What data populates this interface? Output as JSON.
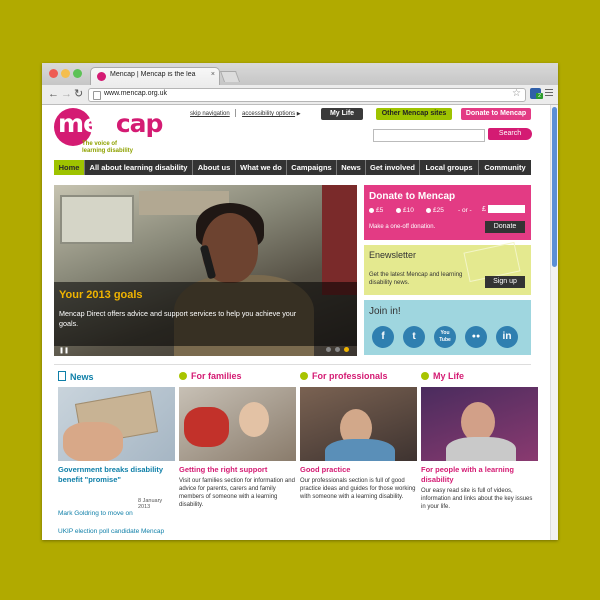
{
  "browser": {
    "tab_title": "Mencap | Mencap is the lea",
    "tab_close": "×",
    "url": "www.mencap.org.uk",
    "ext_badge": "2",
    "back": "←",
    "forward": "→",
    "reload": "↻",
    "star": "☆"
  },
  "header": {
    "logo_pre": "m",
    "logo_mid": "en",
    "logo_post": "cap",
    "tagline": "The voice of\nlearning disability",
    "skip_nav": "skip navigation",
    "accessibility": "accessibility options",
    "my_life": "My Life",
    "other_sites": "Other Mencap sites",
    "donate": "Donate to Mencap",
    "search_button": "Search"
  },
  "nav": [
    "Home",
    "All about learning disability",
    "About us",
    "What we do",
    "Campaigns",
    "News",
    "Get involved",
    "Local groups",
    "Community"
  ],
  "hero": {
    "title": "Your 2013 goals",
    "text": "Mencap Direct offers advice and support services to help you achieve your goals.",
    "controls": "❚❚"
  },
  "donate": {
    "title": "Donate to Mencap",
    "amounts": [
      "£5",
      "£10",
      "£25"
    ],
    "or": "- or -",
    "pound": "£",
    "note": "Make a one-off donation.",
    "button": "Donate"
  },
  "enewsletter": {
    "title": "Enewsletter",
    "text": "Get the latest Mencap and learning disability news.",
    "button": "Sign up"
  },
  "join": {
    "title": "Join in!",
    "icons": [
      "f",
      "t",
      "You\nTube",
      "●●",
      "in"
    ]
  },
  "columns": {
    "news": {
      "heading": "News",
      "sub": "Government breaks disability benefit \"promise\"",
      "date": "8 January 2013",
      "item2": "Mark Goldring to move on",
      "item3": "UKIP election poll candidate Mencap"
    },
    "families": {
      "heading": "For families",
      "sub": "Getting the right support",
      "text": "Visit our families section for information and advice for parents, carers and family members of someone with a learning disability."
    },
    "professionals": {
      "heading": "For professionals",
      "sub": "Good practice",
      "text": "Our professionals section is full of good practice ideas and guides for those working with someone with a learning disability."
    },
    "mylife": {
      "heading": "My Life",
      "sub": "For people with a learning disability",
      "text": "Our easy read site is full of videos, information and links about the key issues in your life."
    }
  },
  "colors": {
    "brand_pink": "#d41b73",
    "brand_green": "#9ec300",
    "backdrop": "#b1aa00",
    "news_blue": "#0e7fa8"
  }
}
